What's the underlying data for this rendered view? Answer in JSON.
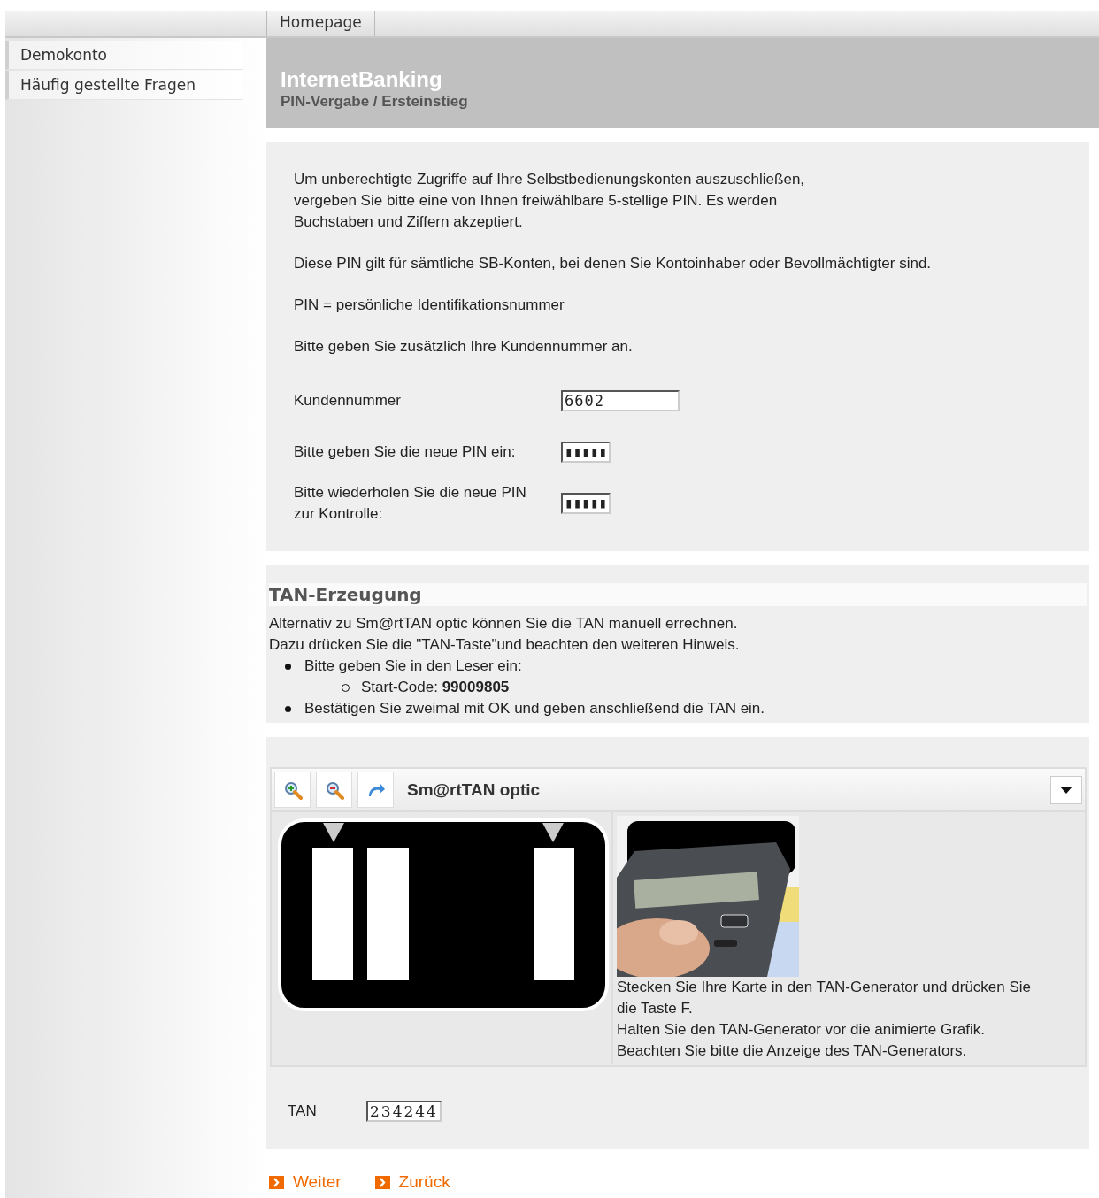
{
  "top_nav": {
    "items": [
      {
        "label": "Homepage"
      }
    ]
  },
  "sidebar": {
    "items": [
      {
        "label": "Demokonto"
      },
      {
        "label": "Häufig gestellte Fragen"
      }
    ]
  },
  "header": {
    "title": "InternetBanking",
    "subtitle": "PIN-Vergabe / Ersteinstieg"
  },
  "pin_section": {
    "paragraphs": [
      "Um unberechtigte Zugriffe auf Ihre Selbstbedienungskonten auszuschließen, vergeben Sie bitte eine von Ihnen freiwählbare 5-stellige PIN. Es werden Buchstaben und Ziffern akzeptiert.",
      "Diese PIN gilt für sämtliche SB-Konten, bei denen Sie Kontoinhaber oder Bevollmächtigter sind.",
      "PIN = persönliche Identifikationsnummer",
      "Bitte geben Sie zusätzlich Ihre Kundennummer an."
    ],
    "fields": [
      {
        "label": "Kundennummer",
        "kind": "text",
        "value": "6602"
      },
      {
        "label": "Bitte geben Sie die neue PIN ein:",
        "kind": "masked",
        "value": "▮▮▮▮▮"
      },
      {
        "label": "Bitte wiederholen Sie die neue PIN zur Kontrolle:",
        "kind": "masked",
        "value": "▮▮▮▮▮"
      }
    ]
  },
  "tan_section": {
    "heading": "TAN-Erzeugung",
    "intro": [
      "Alternativ zu Sm@rtTAN optic können Sie die TAN manuell errechnen.",
      "Dazu drücken Sie die \"TAN-Taste\"und beachten den weiteren Hinweis."
    ],
    "steps": [
      {
        "text": "Bitte geben Sie in den Leser ein:",
        "children": [
          {
            "text": "Start-Code: **99009805**"
          }
        ]
      },
      {
        "text": "Bestätigen Sie zweimal mit OK und geben anschließend die TAN ein."
      }
    ]
  },
  "optic_panel": {
    "title": "Sm@rtTAN optic",
    "toolbar": [
      {
        "kind": "zoom-in"
      },
      {
        "kind": "zoom-out"
      },
      {
        "kind": "reset"
      }
    ],
    "instructions": [
      "Stecken Sie Ihre Karte in den TAN-Generator und drücken Sie die Taste F.",
      "Halten Sie den TAN-Generator vor die animierte Grafik.",
      "Beachten Sie bitte die Anzeige des TAN-Generators."
    ]
  },
  "tan_field": {
    "label": "TAN",
    "value": "234244"
  },
  "links": [
    {
      "label": "Weiter"
    },
    {
      "label": "Zurück"
    }
  ]
}
